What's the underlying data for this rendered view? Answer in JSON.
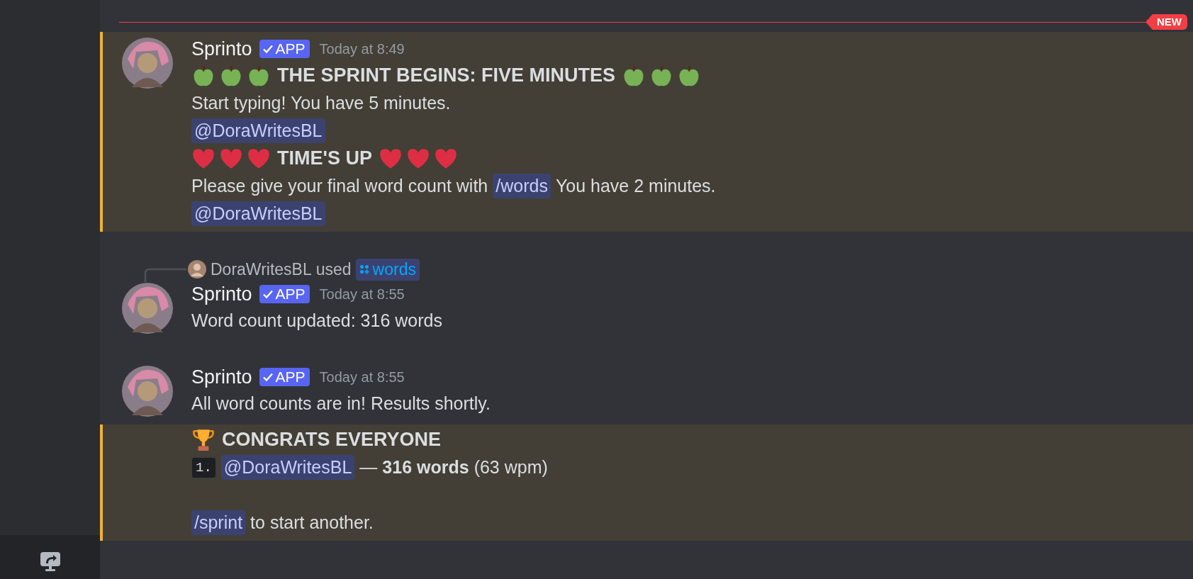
{
  "new_divider": {
    "badge": "NEW"
  },
  "messages": [
    {
      "highlighted": true,
      "author": "Sprinto",
      "badge": "APP",
      "time": "Today at 8:49",
      "lines": [
        {
          "kind": "heading",
          "left_emojis": [
            {
              "kind": "apple"
            },
            {
              "kind": "apple"
            },
            {
              "kind": "apple"
            }
          ],
          "text": "THE SPRINT BEGINS: FIVE MINUTES",
          "right_emojis": [
            {
              "kind": "apple"
            },
            {
              "kind": "apple"
            },
            {
              "kind": "apple"
            }
          ]
        },
        {
          "kind": "text",
          "segments": [
            {
              "kind": "plain",
              "text": "Start typing! You have 5 minutes."
            }
          ]
        },
        {
          "kind": "text",
          "segments": [
            {
              "kind": "mention",
              "text": "@DoraWritesBL"
            }
          ]
        },
        {
          "kind": "heading",
          "left_emojis": [
            {
              "kind": "heart"
            },
            {
              "kind": "heart"
            },
            {
              "kind": "heart"
            }
          ],
          "text": "TIME'S UP",
          "right_emojis": [
            {
              "kind": "heart"
            },
            {
              "kind": "heart"
            },
            {
              "kind": "heart"
            }
          ]
        },
        {
          "kind": "text",
          "segments": [
            {
              "kind": "plain",
              "text": "Please give your final word count with"
            },
            {
              "kind": "command",
              "text": "/words"
            },
            {
              "kind": "plain",
              "text": "You have 2 minutes."
            }
          ]
        },
        {
          "kind": "text",
          "segments": [
            {
              "kind": "mention",
              "text": "@DoraWritesBL"
            }
          ]
        }
      ]
    },
    {
      "highlighted": false,
      "reply": {
        "user": "DoraWritesBL",
        "verb": "used",
        "command": "words"
      },
      "author": "Sprinto",
      "badge": "APP",
      "time": "Today at 8:55",
      "lines": [
        {
          "kind": "text",
          "segments": [
            {
              "kind": "plain",
              "text": "Word count updated: 316 words"
            }
          ]
        }
      ]
    },
    {
      "highlighted": false,
      "author": "Sprinto",
      "badge": "APP",
      "time": "Today at 8:55",
      "lines": [
        {
          "kind": "text",
          "segments": [
            {
              "kind": "plain",
              "text": "All word counts are in! Results shortly."
            }
          ]
        }
      ]
    },
    {
      "highlighted": true,
      "lines": [
        {
          "kind": "heading",
          "left_emojis": [
            {
              "kind": "trophy"
            }
          ],
          "text": "CONGRATS EVERYONE"
        },
        {
          "kind": "text",
          "segments": [
            {
              "kind": "index",
              "text": "1."
            },
            {
              "kind": "mention",
              "text": "@DoraWritesBL"
            },
            {
              "kind": "plain",
              "text": "—"
            },
            {
              "kind": "bold",
              "text": "316 words"
            },
            {
              "kind": "plain",
              "text": "(63 wpm)"
            }
          ]
        },
        {
          "kind": "blank"
        },
        {
          "kind": "text",
          "segments": [
            {
              "kind": "command",
              "text": "/sprint"
            },
            {
              "kind": "plain",
              "text": "to start another."
            }
          ]
        }
      ]
    }
  ]
}
